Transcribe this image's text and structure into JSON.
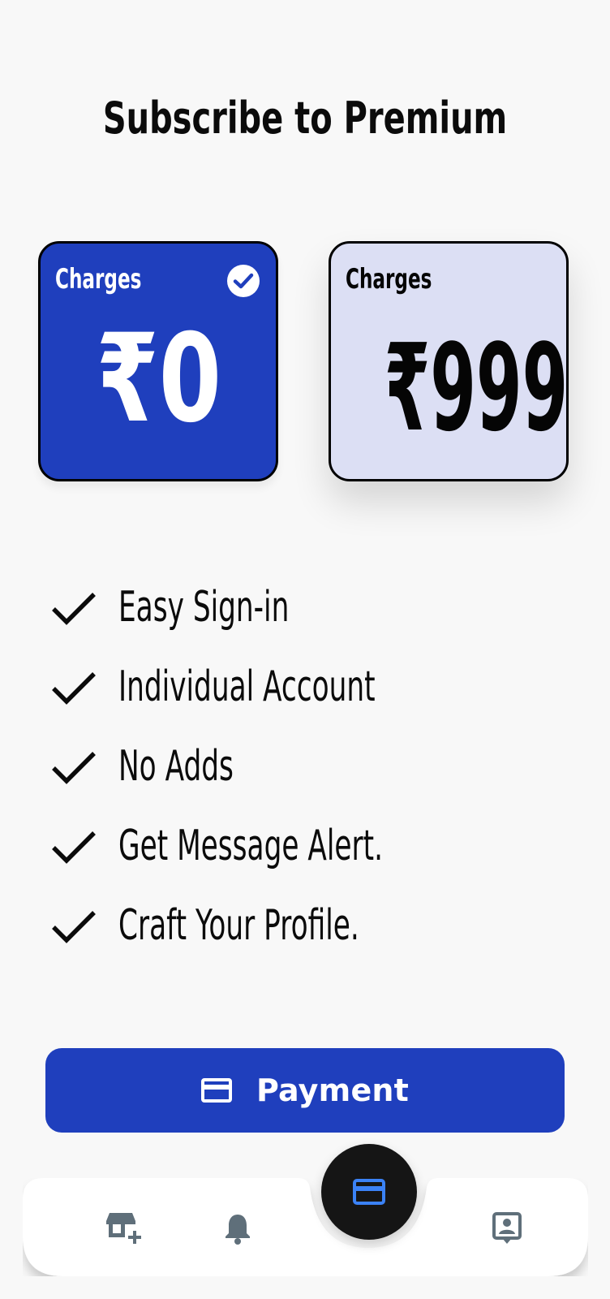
{
  "header": {
    "title": "Subscribe to Premium"
  },
  "plans": [
    {
      "label": "Charges",
      "price": "₹0",
      "selected": true
    },
    {
      "label": "Charges",
      "price": "₹999",
      "selected": false
    }
  ],
  "features": [
    "Easy Sign-in",
    "Individual Account",
    "No Adds",
    "Get Message Alert.",
    "Craft Your Profile."
  ],
  "payment_button": {
    "label": "Payment",
    "icon": "credit-card-icon"
  },
  "bottom_nav": {
    "items": [
      {
        "icon": "store-add-icon",
        "active": false
      },
      {
        "icon": "bell-icon",
        "active": false
      },
      {
        "icon": "credit-card-icon",
        "active": true
      },
      {
        "icon": "contact-profile-icon",
        "active": false
      }
    ]
  },
  "colors": {
    "primary": "#1F3FBD",
    "selected_card": "#1F3FBD",
    "unselected_card": "#DCDFF4",
    "fab": "#151515",
    "fab_icon": "#3B82F6",
    "nav_icon": "#5F6F7A",
    "background": "#F8F8F8"
  }
}
